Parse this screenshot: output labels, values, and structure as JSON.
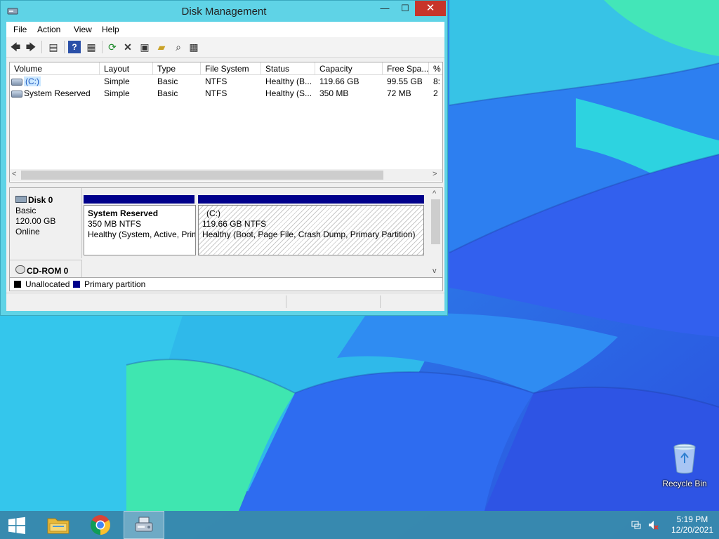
{
  "window": {
    "title": "Disk Management",
    "minimize_glyph": "—",
    "maximize_glyph": "☐",
    "close_glyph": "✕"
  },
  "menu": [
    "File",
    "Action",
    "View",
    "Help"
  ],
  "toolbar": {
    "icons": [
      "back-icon",
      "forward-icon",
      "show-hide-console-tree-icon",
      "help-icon",
      "show-hide-action-pane-icon",
      "refresh-icon",
      "delete-icon",
      "properties-icon",
      "open-icon",
      "search-icon",
      "rescan-disks-icon"
    ]
  },
  "volume_table": {
    "columns": [
      "Volume",
      "Layout",
      "Type",
      "File System",
      "Status",
      "Capacity",
      "Free Spa...",
      "%"
    ],
    "rows": [
      {
        "volume": "(C:)",
        "layout": "Simple",
        "type": "Basic",
        "fs": "NTFS",
        "status": "Healthy (B...",
        "capacity": "119.66 GB",
        "free": "99.55 GB",
        "pct": "8:"
      },
      {
        "volume": "System Reserved",
        "layout": "Simple",
        "type": "Basic",
        "fs": "NTFS",
        "status": "Healthy (S...",
        "capacity": "350 MB",
        "free": "72 MB",
        "pct": "2"
      }
    ]
  },
  "disks": [
    {
      "name": "Disk 0",
      "type": "Basic",
      "size": "120.00 GB",
      "state": "Online",
      "partitions": [
        {
          "title": "System Reserved",
          "line1": "350 MB NTFS",
          "line2": "Healthy (System, Active, Primary Partition)"
        },
        {
          "title": "(C:)",
          "line1": "119.66 GB NTFS",
          "line2": "Healthy (Boot, Page File, Crash Dump, Primary Partition)"
        }
      ]
    },
    {
      "name": "CD-ROM 0"
    }
  ],
  "legend": {
    "unallocated": "Unallocated",
    "primary": "Primary partition",
    "unallocated_color": "#000000",
    "primary_color": "#00008b"
  },
  "desktop": {
    "recycle_bin_label": "Recycle Bin"
  },
  "taskbar": {
    "apps": [
      "start-icon",
      "file-explorer-icon",
      "chrome-icon",
      "disk-management-icon"
    ],
    "time": "5:19 PM",
    "date": "12/20/2021"
  },
  "colors": {
    "titlebar": "#5fd3e6",
    "close_button": "#c7342a",
    "partition_bar": "#00008b",
    "taskbar": "#388caa"
  }
}
